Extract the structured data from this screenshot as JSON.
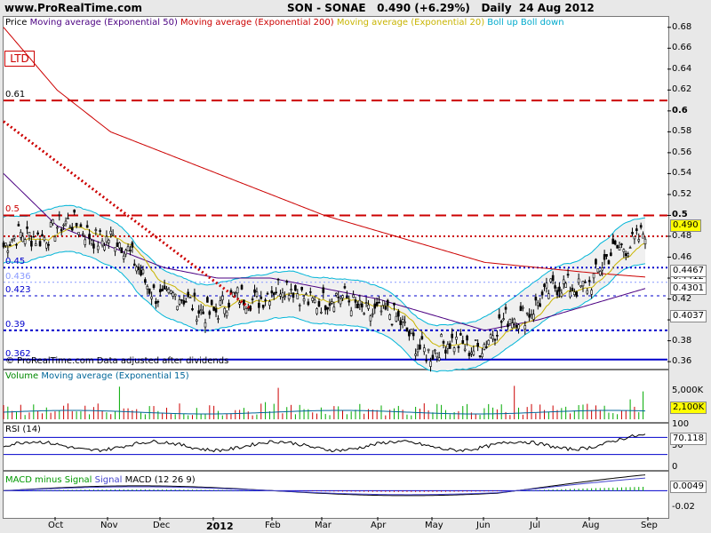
{
  "header": {
    "site": "www.ProRealTime.com",
    "title": "SON - SONAE   0.490 (+6.29%)   Daily  24 Aug 2012"
  },
  "main": {
    "legend": [
      {
        "text": "Price",
        "color": "#000000"
      },
      {
        "text": "Moving average (Exponential 50)",
        "color": "#4b0082"
      },
      {
        "text": "Moving average (Exponential 200)",
        "color": "#cc0000"
      },
      {
        "text": "Moving average (Exponential 20)",
        "color": "#c8b400"
      },
      {
        "text": "Boll up Boll down",
        "color": "#00aacc"
      }
    ],
    "ltd": "LTD",
    "footnote": "© ProRealTime.com  Data adjusted after dividends",
    "levels": [
      {
        "label": "0.61",
        "value": 0.61
      },
      {
        "label": "0.5",
        "value": 0.5
      },
      {
        "label": "0.45",
        "value": 0.45
      },
      {
        "label": "0.436",
        "value": 0.436
      },
      {
        "label": "0.423",
        "value": 0.423
      },
      {
        "label": "0.39",
        "value": 0.39
      },
      {
        "label": "0.362",
        "value": 0.362
      }
    ],
    "yticks": [
      "0.68",
      "0.66",
      "0.64",
      "0.62",
      "0.6",
      "0.58",
      "0.56",
      "0.54",
      "0.52",
      "0.5",
      "0.48",
      "0.46",
      "0.44",
      "0.42",
      "0.4",
      "0.38",
      "0.36"
    ],
    "boxes": [
      {
        "text": "0.490",
        "bg": "#ffff00"
      },
      {
        "text": "0.4412",
        "bg": "#ffffff"
      },
      {
        "text": "0.4301",
        "bg": "#ffffff"
      },
      {
        "text": "0.4037",
        "bg": "#ffffff"
      },
      {
        "text": "0.4467",
        "bg": "#ffffff"
      }
    ]
  },
  "volume": {
    "legend": "Volume",
    "legend2": "Moving average (Exponential 15)",
    "ytick": "5,000K",
    "box": "2,100K"
  },
  "rsi": {
    "legend": "RSI (14)",
    "yticks": [
      "100",
      "50",
      "0"
    ],
    "box": "70.118"
  },
  "macd": {
    "legend": "MACD minus Signal",
    "legend2": "Signal",
    "legend3": "MACD (12 26 9)",
    "yticks": [
      "0",
      "-0.02"
    ],
    "box": "0.0049"
  },
  "xaxis": {
    "labels": [
      {
        "t": "Oct",
        "bold": false
      },
      {
        "t": "Nov",
        "bold": false
      },
      {
        "t": "Dec",
        "bold": false
      },
      {
        "t": "2012",
        "bold": true
      },
      {
        "t": "Feb",
        "bold": false
      },
      {
        "t": "Mar",
        "bold": false
      },
      {
        "t": "Apr",
        "bold": false
      },
      {
        "t": "May",
        "bold": false
      },
      {
        "t": "Jun",
        "bold": false
      },
      {
        "t": "Jul",
        "bold": false
      },
      {
        "t": "Aug",
        "bold": false
      },
      {
        "t": "Sep",
        "bold": false
      }
    ]
  },
  "chart_data": {
    "type": "line",
    "title": "SON - SONAE   0.490 (+6.29%)   Daily  24 Aug 2012",
    "ylim": [
      0.355,
      0.69
    ],
    "x": [
      "Sep",
      "Oct",
      "Nov",
      "Dec",
      "Jan",
      "Feb",
      "Mar",
      "Apr",
      "May",
      "Jun",
      "Jul",
      "Aug",
      "Sep"
    ],
    "series": [
      {
        "name": "Price",
        "color": "#000000",
        "values": [
          0.47,
          0.49,
          0.48,
          0.42,
          0.41,
          0.43,
          0.42,
          0.41,
          0.37,
          0.38,
          0.42,
          0.44,
          0.49
        ]
      },
      {
        "name": "Moving average (Exponential 50)",
        "color": "#4b0082",
        "values": [
          0.54,
          0.49,
          0.47,
          0.45,
          0.44,
          0.44,
          0.43,
          0.42,
          0.405,
          0.39,
          0.4,
          0.415,
          0.43
        ]
      },
      {
        "name": "Moving average (Exponential 200)",
        "color": "#cc0000",
        "values": [
          0.68,
          0.62,
          0.58,
          0.56,
          0.54,
          0.52,
          0.5,
          0.485,
          0.47,
          0.455,
          0.45,
          0.445,
          0.441
        ]
      }
    ],
    "hlines": [
      0.61,
      0.5,
      0.48,
      0.45,
      0.436,
      0.423,
      0.39,
      0.362
    ]
  }
}
